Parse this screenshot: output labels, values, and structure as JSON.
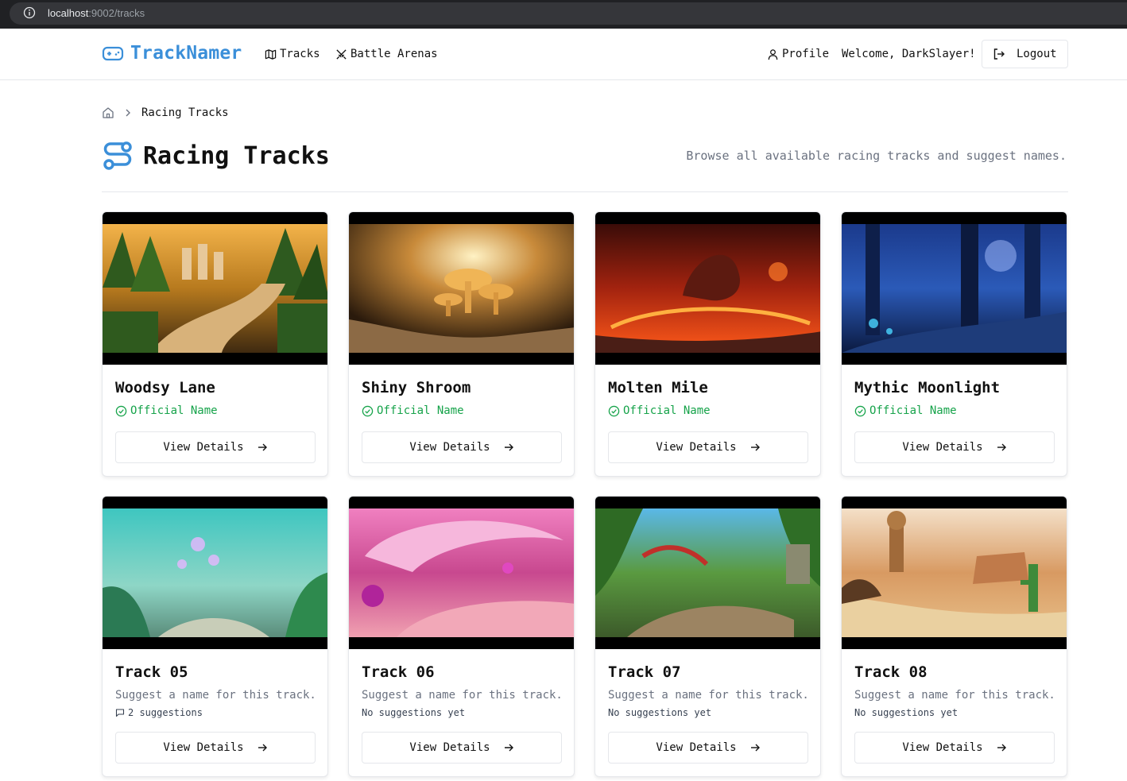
{
  "browser": {
    "url_host": "localhost",
    "url_rest": ":9002/tracks"
  },
  "nav": {
    "brand": "TrackNamer",
    "links": [
      "Tracks",
      "Battle Arenas"
    ],
    "profile": "Profile",
    "welcome": "Welcome, DarkSlayer!",
    "logout": "Logout"
  },
  "breadcrumb": {
    "current": "Racing Tracks"
  },
  "header": {
    "title": "Racing Tracks",
    "description": "Browse all available racing tracks and suggest names."
  },
  "tracks": [
    {
      "name": "Woodsy Lane",
      "status": "Official Name",
      "button": "View Details"
    },
    {
      "name": "Shiny Shroom",
      "status": "Official Name",
      "button": "View Details"
    },
    {
      "name": "Molten Mile",
      "status": "Official Name",
      "button": "View Details"
    },
    {
      "name": "Mythic Moonlight",
      "status": "Official Name",
      "button": "View Details"
    },
    {
      "name": "Track 05",
      "prompt": "Suggest a name for this track.",
      "suggestions": "2 suggestions",
      "button": "View Details"
    },
    {
      "name": "Track 06",
      "prompt": "Suggest a name for this track.",
      "suggestions": "No suggestions yet",
      "button": "View Details"
    },
    {
      "name": "Track 07",
      "prompt": "Suggest a name for this track.",
      "suggestions": "No suggestions yet",
      "button": "View Details"
    },
    {
      "name": "Track 08",
      "prompt": "Suggest a name for this track.",
      "suggestions": "No suggestions yet",
      "button": "View Details"
    }
  ],
  "colors": {
    "brand": "#3b8fd9",
    "official": "#16a34a",
    "muted": "#6b7280"
  },
  "icons": [
    "info-icon",
    "gamepad-icon",
    "map-icon",
    "swords-icon",
    "user-icon",
    "logout-icon",
    "home-icon",
    "chevron-right-icon",
    "route-icon",
    "check-circle-icon",
    "arrow-right-icon",
    "message-icon"
  ]
}
